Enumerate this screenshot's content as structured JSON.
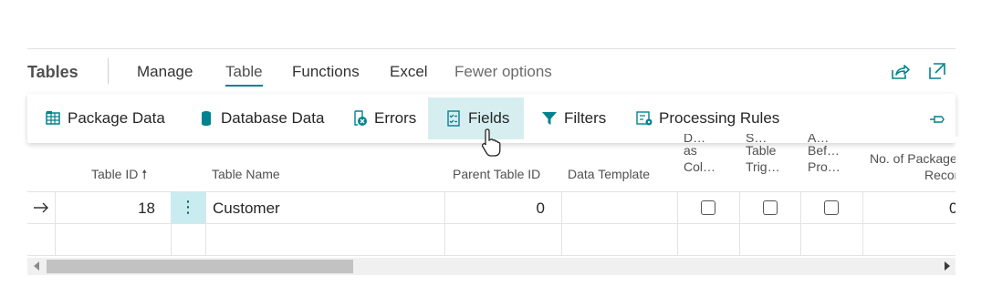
{
  "header": {
    "title": "Tables",
    "tabs": [
      {
        "label": "Manage"
      },
      {
        "label": "Table"
      },
      {
        "label": "Functions"
      },
      {
        "label": "Excel"
      },
      {
        "label": "Fewer options"
      }
    ]
  },
  "actions": [
    {
      "label": "Package Data",
      "icon": "package-data-icon"
    },
    {
      "label": "Database Data",
      "icon": "database-icon"
    },
    {
      "label": "Errors",
      "icon": "errors-icon"
    },
    {
      "label": "Fields",
      "icon": "fields-icon"
    },
    {
      "label": "Filters",
      "icon": "filter-icon"
    },
    {
      "label": "Processing Rules",
      "icon": "processing-rules-icon"
    }
  ],
  "columns": {
    "table_id": "Table ID",
    "table_name": "Table Name",
    "parent_table_id": "Parent Table ID",
    "data_template": "Data Template",
    "col5_l1": "D…",
    "col5_l2": "as",
    "col5_l3": "Col…",
    "col6_l1": "S…",
    "col6_l2": "Table",
    "col6_l3": "Trig…",
    "col7_l1": "A…",
    "col7_l2": "Bef…",
    "col7_l3": "Pro…",
    "no_package_l1": "No. of Package",
    "no_package_l2": "Records"
  },
  "rows": [
    {
      "table_id": "18",
      "table_name": "Customer",
      "parent_table_id": "0",
      "data_template": "",
      "col5": false,
      "col6": false,
      "col7": false,
      "no_package_records": "0"
    }
  ],
  "colors": {
    "accent": "#00838f",
    "selected_bg": "#d6eef0"
  }
}
